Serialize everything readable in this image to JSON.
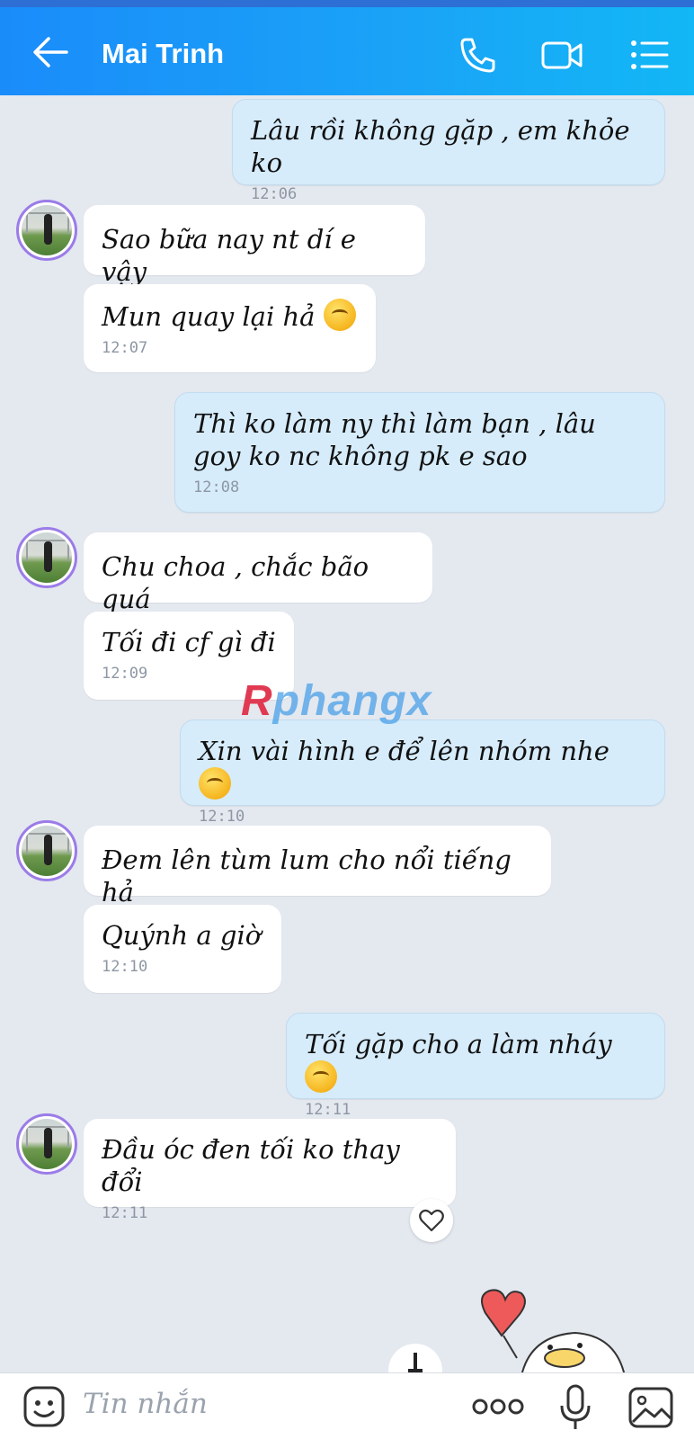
{
  "header": {
    "contact_name": "Mai Trinh"
  },
  "messages": [
    {
      "dir": "out",
      "text": "Lâu rồi không gặp , em khỏe ko",
      "time": "12:06"
    },
    {
      "dir": "in",
      "text": "Sao bữa nay nt dí e vậy",
      "time": ""
    },
    {
      "dir": "in",
      "text": "Mun quay lại hả",
      "time": "12:07"
    },
    {
      "dir": "out",
      "text": "Thì ko làm ny thì làm bạn , lâu goy ko nc không pk e sao",
      "time": "12:08"
    },
    {
      "dir": "in",
      "text": "Chu choa , chắc bão quá",
      "time": ""
    },
    {
      "dir": "in",
      "text": "Tối đi cf gì đi",
      "time": "12:09"
    },
    {
      "dir": "out",
      "text": "Xin vài hình e để lên nhóm nhe",
      "time": "12:10"
    },
    {
      "dir": "in",
      "text": "Đem lên tùm lum cho nổi tiếng hả",
      "time": ""
    },
    {
      "dir": "in",
      "text": "Quýnh a giờ",
      "time": "12:10"
    },
    {
      "dir": "out",
      "text": "Tối gặp cho a làm nháy",
      "time": "12:11"
    },
    {
      "dir": "in",
      "text": "Đầu óc đen tối ko thay đổi",
      "time": "12:11"
    }
  ],
  "watermark": {
    "first": "R",
    "rest": "phangx"
  },
  "composer": {
    "placeholder": "Tin nhắn"
  },
  "colors": {
    "header": "#1a9af8",
    "outgoing_bubble": "#d6ecfb",
    "incoming_bubble": "#ffffff",
    "background": "#e4e8ef"
  }
}
